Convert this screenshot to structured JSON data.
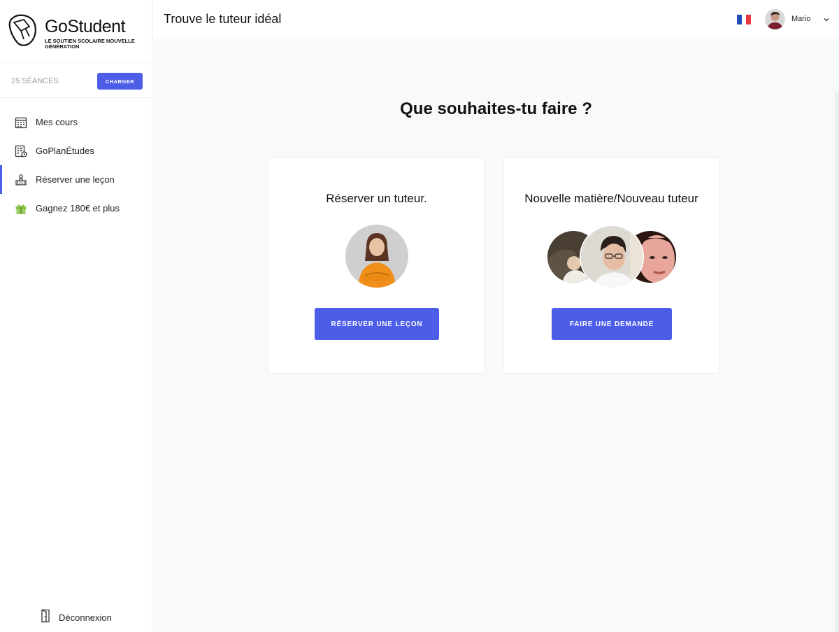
{
  "brand": {
    "name": "GoStudent",
    "tagline": "LE SOUTIEN SCOLAIRE NOUVELLE GÉNÉRATION"
  },
  "sessions": {
    "label": "25 SÉANCES",
    "button_label": "CHARGER"
  },
  "sidebar": {
    "items": [
      {
        "label": "Mes cours",
        "icon": "calendar-icon"
      },
      {
        "label": "GoPlanÉtudes",
        "icon": "study-plan-icon"
      },
      {
        "label": "Réserver une leçon",
        "icon": "book-lesson-icon",
        "active": true
      },
      {
        "label": "Gagnez 180€ et plus",
        "icon": "gift-icon"
      }
    ],
    "logout_label": "Déconnexion"
  },
  "header": {
    "title": "Trouve le tuteur idéal",
    "user_name": "Mario"
  },
  "main": {
    "title": "Que souhaites-tu faire ?",
    "cards": [
      {
        "title": "Réserver un tuteur.",
        "button_label": "RÉSERVER UNE LEÇON"
      },
      {
        "title": "Nouvelle matière/Nouveau tuteur",
        "button_label": "FAIRE UNE DEMANDE"
      }
    ]
  },
  "colors": {
    "accent": "#4c5ee8",
    "gift_green": "#8bc34a",
    "flag_blue": "#1f4fb6",
    "flag_red": "#e5383b"
  }
}
